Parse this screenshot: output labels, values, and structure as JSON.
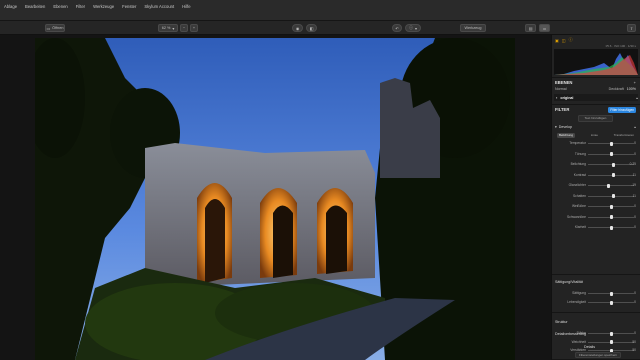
{
  "menu": [
    "Ablage",
    "Bearbeiten",
    "Ebenen",
    "Filter",
    "Werkzeuge",
    "Fenster",
    "Skylum Account",
    "Hilfe"
  ],
  "toolbar": {
    "left_button": "Öffnen",
    "zoom_label": "62 %",
    "compare_label": "Werkzeug"
  },
  "panel": {
    "histogram_info": "f/5.6 · ISO 100 · 1/30 s",
    "layers_header": "EBENEN",
    "mode_label": "Normal",
    "opacity_label": "Deckkraft",
    "opacity_value": "100%",
    "layer_name": "original",
    "filter_header": "FILTER",
    "filter_button": "Filter hinzufügen",
    "preset_label": "Text hinzufügen",
    "develop_label": "Develop",
    "tabs": [
      "Belichtung",
      "Linse",
      "Transformieren"
    ],
    "sliders1": [
      {
        "name": "Temperatur",
        "value": "0"
      },
      {
        "name": "Tönung",
        "value": "0"
      },
      {
        "name": "Belichtung",
        "value": "0.25"
      },
      {
        "name": "Kontrast",
        "value": "11"
      },
      {
        "name": "Glanzlichter",
        "value": "-19"
      },
      {
        "name": "Schatten",
        "value": "11"
      },
      {
        "name": "Weißtöne",
        "value": "0"
      },
      {
        "name": "Schwarztöne",
        "value": "0"
      },
      {
        "name": "Klarheit",
        "value": "0"
      }
    ],
    "section2_header": "Sättigung/Vitalität",
    "sliders2": [
      {
        "name": "Sättigung",
        "value": "0"
      },
      {
        "name": "Lebendigkeit",
        "value": "0"
      }
    ],
    "section3_header": "Struktur",
    "sliders3": [
      {
        "name": "Stärke",
        "value": "0"
      },
      {
        "name": "Weichheit",
        "value": "50"
      },
      {
        "name": "Verstärken",
        "value": "50"
      }
    ],
    "section4_header": "Detailverbesserung",
    "details_label": "Details",
    "footer_button": "Filtereinstellungen speichern"
  },
  "colors": {
    "accent": "#2b86e0",
    "panel_bg": "#232323",
    "menubar_bg": "#2a2a2a"
  }
}
